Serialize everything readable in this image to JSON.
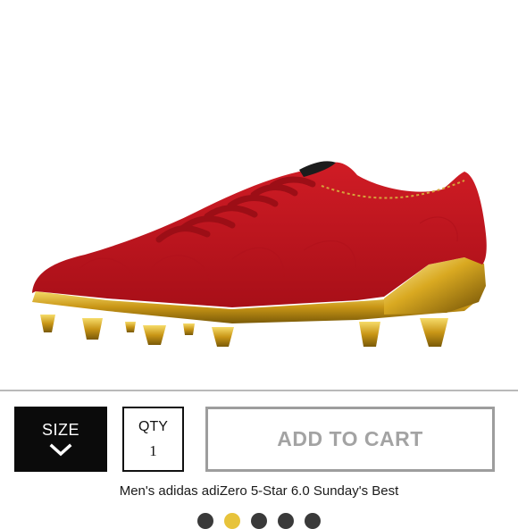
{
  "product": {
    "name": "Men's adidas adiZero 5-Star 6.0 Sunday's Best",
    "image_icon": "football-cleat-image"
  },
  "controls": {
    "size_label": "SIZE",
    "size_icon": "chevron-down-icon",
    "qty_label": "QTY",
    "qty_value": "1",
    "add_to_cart_label": "ADD TO CART"
  },
  "carousel": {
    "dot_count": 5,
    "active_index": 1
  },
  "colors": {
    "shoe_red": "#c4151f",
    "gold": "#d4a21c",
    "active_dot": "#e7c33b"
  }
}
